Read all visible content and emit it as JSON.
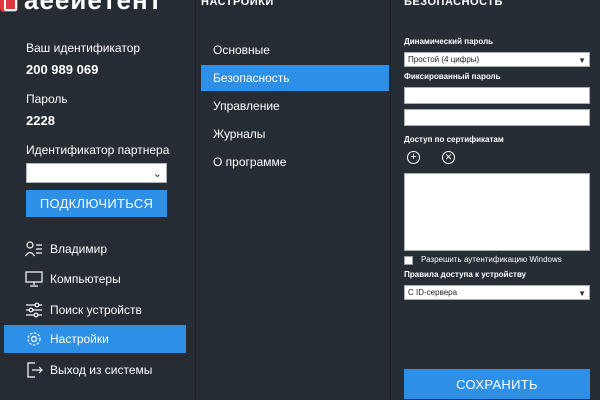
{
  "app": {
    "logo_text": "aeeиeтeнт"
  },
  "left": {
    "id_label": "Ваш идентификатор",
    "id_value": "200 989 069",
    "password_label": "Пароль",
    "password_value": "2228",
    "partner_label": "Идентификатор партнера",
    "partner_value": "",
    "connect_button": "ПОДКЛЮЧИТЬСЯ",
    "nav": [
      {
        "label": "Владимир",
        "icon": "user-list-icon"
      },
      {
        "label": "Компьютеры",
        "icon": "monitor-icon"
      },
      {
        "label": "Поиск устройств",
        "icon": "sliders-icon"
      },
      {
        "label": "Настройки",
        "icon": "gear-icon",
        "active": true
      },
      {
        "label": "Выход из системы",
        "icon": "logout-icon"
      }
    ]
  },
  "middle": {
    "title": "НАСТРОЙКИ",
    "items": [
      {
        "label": "Основные"
      },
      {
        "label": "Безопасность",
        "active": true
      },
      {
        "label": "Управление"
      },
      {
        "label": "Журналы"
      },
      {
        "label": "О программе"
      }
    ]
  },
  "right": {
    "title": "БЕЗОПАСНОСТЬ",
    "dynamic_password_label": "Динамический пароль",
    "dynamic_password_value": "Простой (4 цифры)",
    "fixed_password_label": "Фиксированный пароль",
    "fixed_password_value": "",
    "fixed_password_confirm_value": "",
    "cert_access_label": "Доступ по сертификатам",
    "windows_auth_label": "Разрешить аутентификацию Windows",
    "windows_auth_checked": false,
    "access_rules_label": "Правила доступа к устройству",
    "access_rules_value": "С ID-сервера",
    "save_button": "СОХРАНИТЬ"
  },
  "colors": {
    "accent": "#2d8fe6",
    "background": "#252c34",
    "logo_red": "#e0363d"
  }
}
